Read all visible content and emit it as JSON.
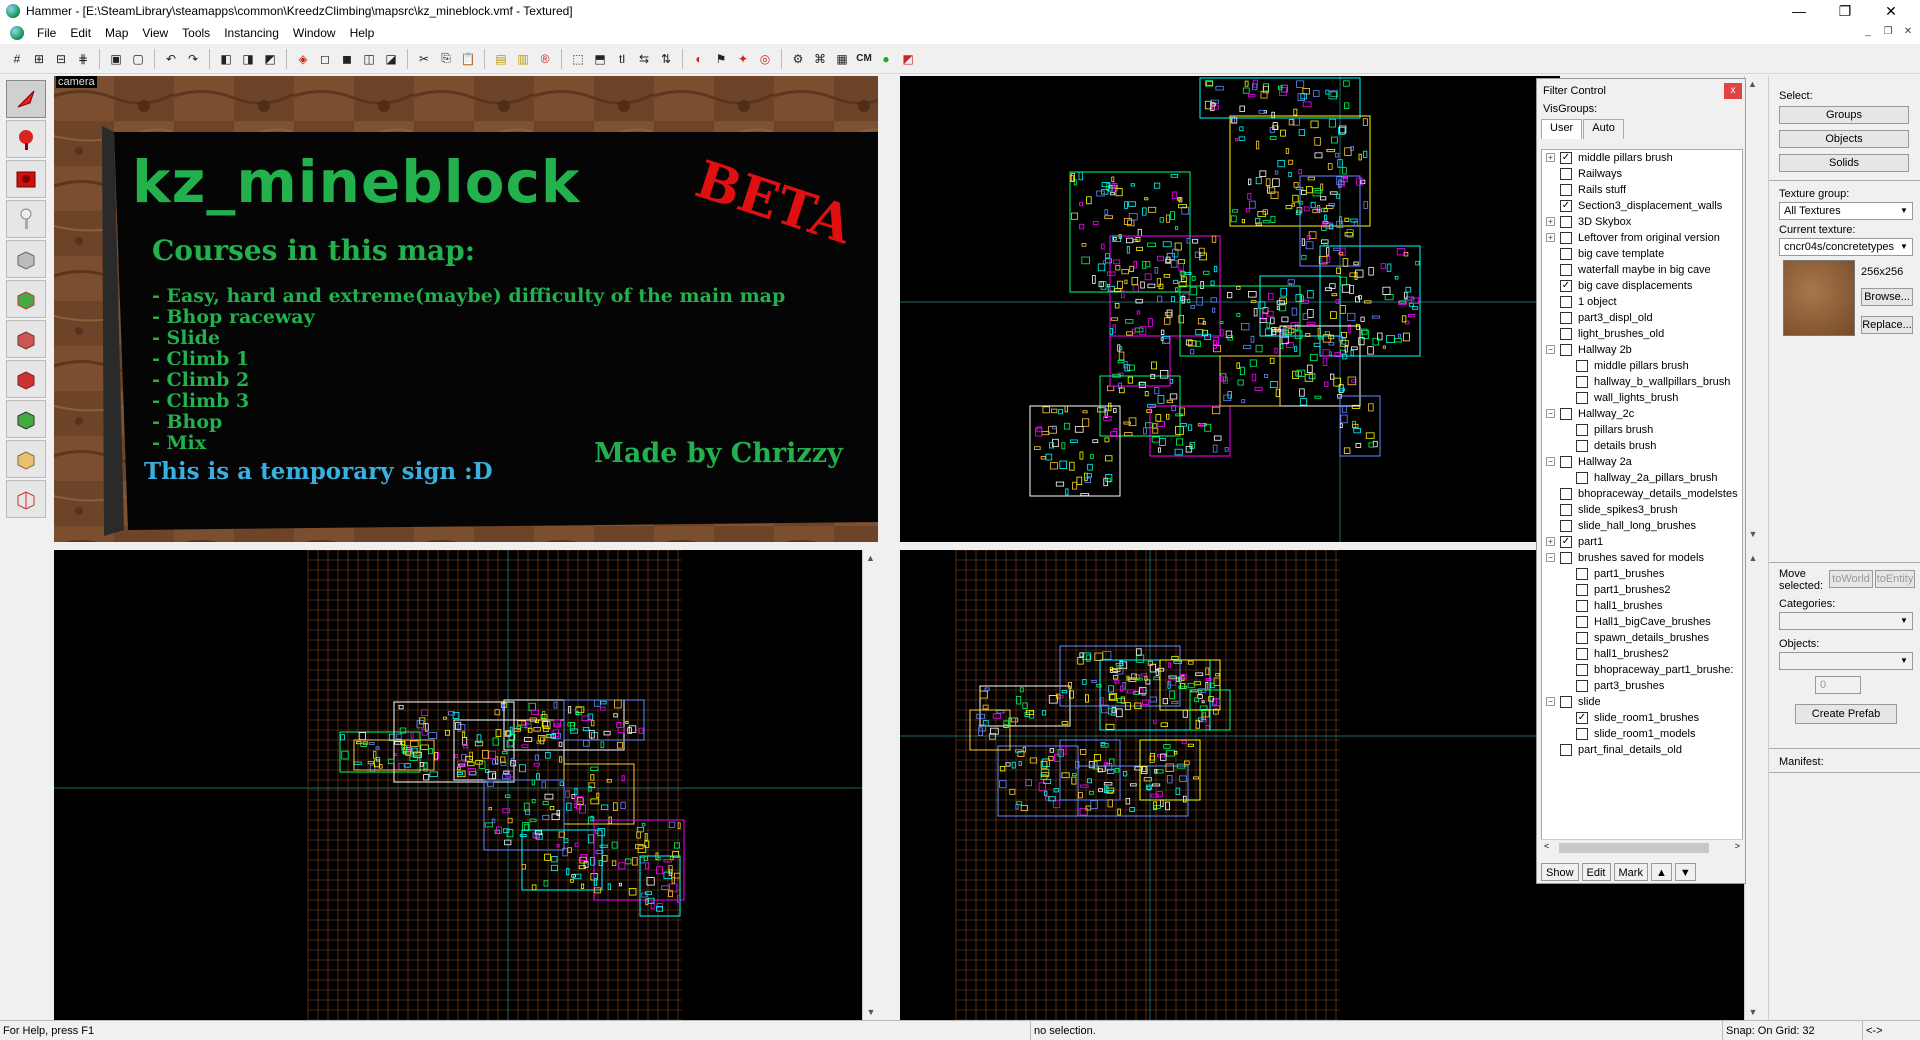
{
  "window": {
    "title": "Hammer - [E:\\SteamLibrary\\steamapps\\common\\KreedzClimbing\\mapsrc\\kz_mineblock.vmf - Textured]",
    "minimize": "—",
    "maximize": "❐",
    "close": "✕"
  },
  "menu": {
    "items": [
      "File",
      "Edit",
      "Map",
      "View",
      "Tools",
      "Instancing",
      "Window",
      "Help"
    ],
    "mdi_minimize": "_",
    "mdi_restore": "❐",
    "mdi_close": "✕"
  },
  "toolbar": {
    "cm_label": "CM"
  },
  "viewports": {
    "camera_label": "camera",
    "sign": {
      "title": "kz_mineblock",
      "beta": "BETA",
      "courses_heading": "Courses in this map:",
      "courses": [
        "- Easy, hard and extreme(maybe) difficulty of the main map",
        "- Bhop raceway",
        "- Slide",
        "- Climb 1",
        "- Climb 2",
        "- Climb 3",
        "- Bhop",
        "- Mix"
      ],
      "temporary": "This is a temporary sign :D",
      "author": "Made by Chrizzy"
    }
  },
  "filter_control": {
    "title": "Filter Control",
    "close": "x",
    "visgroups_label": "VisGroups:",
    "tabs": [
      "User",
      "Auto"
    ],
    "items": [
      {
        "label": "middle pillars brush",
        "level": 0,
        "expand": "+",
        "checked": true
      },
      {
        "label": "Railways",
        "level": 0,
        "expand": "",
        "checked": false
      },
      {
        "label": "Rails stuff",
        "level": 0,
        "expand": "",
        "checked": false
      },
      {
        "label": "Section3_displacement_walls",
        "level": 0,
        "expand": "",
        "checked": true
      },
      {
        "label": "3D Skybox",
        "level": 0,
        "expand": "+",
        "checked": false
      },
      {
        "label": "Leftover from original version",
        "level": 0,
        "expand": "+",
        "checked": false
      },
      {
        "label": "big cave template",
        "level": 0,
        "expand": "",
        "checked": false
      },
      {
        "label": "waterfall maybe in big cave",
        "level": 0,
        "expand": "",
        "checked": false
      },
      {
        "label": "big cave displacements",
        "level": 0,
        "expand": "",
        "checked": true
      },
      {
        "label": "1 object",
        "level": 0,
        "expand": "",
        "checked": false
      },
      {
        "label": "part3_displ_old",
        "level": 0,
        "expand": "",
        "checked": false
      },
      {
        "label": "light_brushes_old",
        "level": 0,
        "expand": "",
        "checked": false
      },
      {
        "label": "Hallway 2b",
        "level": 0,
        "expand": "−",
        "checked": false
      },
      {
        "label": "middle pillars brush",
        "level": 1,
        "expand": "",
        "checked": false
      },
      {
        "label": "hallway_b_wallpillars_brush",
        "level": 1,
        "expand": "",
        "checked": false
      },
      {
        "label": "wall_lights_brush",
        "level": 1,
        "expand": "",
        "checked": false
      },
      {
        "label": "Hallway_2c",
        "level": 0,
        "expand": "−",
        "checked": false
      },
      {
        "label": "pillars brush",
        "level": 1,
        "expand": "",
        "checked": false
      },
      {
        "label": "details brush",
        "level": 1,
        "expand": "",
        "checked": false
      },
      {
        "label": "Hallway 2a",
        "level": 0,
        "expand": "−",
        "checked": false
      },
      {
        "label": "hallway_2a_pillars_brush",
        "level": 1,
        "expand": "",
        "checked": false
      },
      {
        "label": "bhopraceway_details_modelstes",
        "level": 0,
        "expand": "",
        "checked": false
      },
      {
        "label": "slide_spikes3_brush",
        "level": 0,
        "expand": "",
        "checked": false
      },
      {
        "label": "slide_hall_long_brushes",
        "level": 0,
        "expand": "",
        "checked": false
      },
      {
        "label": "part1",
        "level": 0,
        "expand": "+",
        "checked": true
      },
      {
        "label": "brushes saved for models",
        "level": 0,
        "expand": "−",
        "checked": false
      },
      {
        "label": "part1_brushes",
        "level": 1,
        "expand": "",
        "checked": false
      },
      {
        "label": "part1_brushes2",
        "level": 1,
        "expand": "",
        "checked": false
      },
      {
        "label": "hall1_brushes",
        "level": 1,
        "expand": "",
        "checked": false
      },
      {
        "label": "Hall1_bigCave_brushes",
        "level": 1,
        "expand": "",
        "checked": false
      },
      {
        "label": "spawn_details_brushes",
        "level": 1,
        "expand": "",
        "checked": false
      },
      {
        "label": "hall1_brushes2",
        "level": 1,
        "expand": "",
        "checked": false
      },
      {
        "label": "bhopraceway_part1_brushe:",
        "level": 1,
        "expand": "",
        "checked": false
      },
      {
        "label": "part3_brushes",
        "level": 1,
        "expand": "",
        "checked": false
      },
      {
        "label": "slide",
        "level": 0,
        "expand": "−",
        "checked": false
      },
      {
        "label": "slide_room1_brushes",
        "level": 1,
        "expand": "",
        "checked": true
      },
      {
        "label": "slide_room1_models",
        "level": 1,
        "expand": "",
        "checked": false
      },
      {
        "label": "part_final_details_old",
        "level": 0,
        "expand": "",
        "checked": false
      }
    ],
    "buttons": [
      "Show",
      "Edit",
      "Mark"
    ],
    "up_arrow": "▲",
    "down_arrow": "▼",
    "scroll_left": "<",
    "scroll_right": ">"
  },
  "right_panel": {
    "select_label": "Select:",
    "groups_btn": "Groups",
    "objects_btn": "Objects",
    "solids_btn": "Solids",
    "texture_group_label": "Texture group:",
    "texture_group_value": "All Textures",
    "current_texture_label": "Current texture:",
    "current_texture_value": "cncr04s/concretetypes",
    "texture_size": "256x256",
    "browse_btn": "Browse...",
    "replace_btn": "Replace...",
    "move_selected_label": "Move selected:",
    "toworld_btn": "toWorld",
    "toentity_btn": "toEntity",
    "categories_label": "Categories:",
    "objects_label": "Objects:",
    "objects_count": "0",
    "create_prefab_btn": "Create Prefab",
    "manifest_label": "Manifest:"
  },
  "status": {
    "help": "For Help, press F1",
    "selection": "no selection.",
    "snap": "Snap: On Grid: 32",
    "arrows": "<->"
  },
  "colors": {
    "accent_red": "#e04343",
    "sign_green": "#22b14c",
    "sign_blue": "#3ab0e0",
    "sign_red": "#e01010",
    "grid_orange": "#8a4a1e",
    "wood": "#7a4a2a"
  }
}
